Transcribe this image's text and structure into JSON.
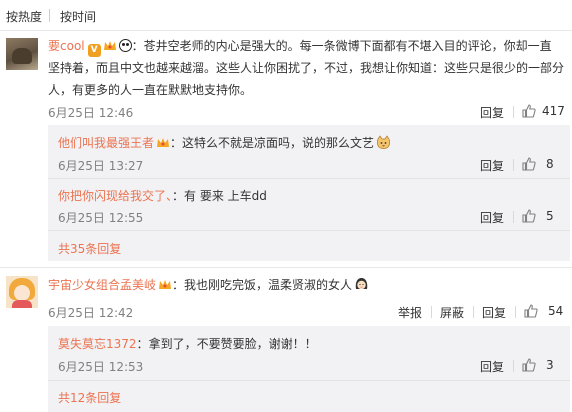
{
  "sort": {
    "hot": "按热度",
    "time": "按时间"
  },
  "c1": {
    "user": "要cool",
    "colon": "：",
    "line1": "苍井空老师的内心是强大的。每一条微博下面都有不堪入目的评论，你却一直",
    "line2": "坚持着，而且中文也越来越溜。这些人让你困扰了，不过，我想让你知道：这些只是很少的一部分",
    "line3": "人，有更多的人一直在默默地支持你。",
    "date": "6月25日 12:46",
    "reply": "回复",
    "likes": "417"
  },
  "r1": {
    "user": "他们叫我最强王者",
    "colon": "：",
    "text": "这特么不就是凉面吗，说的那么文艺",
    "date": "6月25日 13:27",
    "reply": "回复",
    "likes": "8"
  },
  "r2": {
    "user": "你把你闪现给我交了、",
    "colon": "：",
    "text": "有 要来 上车dd",
    "date": "6月25日 12:55",
    "reply": "回复",
    "likes": "5"
  },
  "more1": "共35条回复",
  "c2": {
    "user": "宇宙少女组合孟美岐",
    "colon": "：",
    "text": "我也刚吃完饭，温柔贤淑的女人",
    "date": "6月25日 12:42",
    "report": "举报",
    "block": "屏蔽",
    "reply": "回复",
    "likes": "54"
  },
  "r3": {
    "user": "莫失莫忘1372",
    "colon": "：",
    "text": "拿到了，不要赞要脸，谢谢！！",
    "date": "6月25日 12:53",
    "reply": "回复",
    "likes": "3"
  },
  "more2": "共12条回复",
  "icons": [
    "thumbs-up-icon",
    "crown-icon",
    "panda-icon",
    "cat-face-emoji",
    "woman-face-emoji"
  ],
  "colors": {
    "username": "#eb7350",
    "date": "#808080",
    "reply_bg": "#f2f2f5"
  }
}
